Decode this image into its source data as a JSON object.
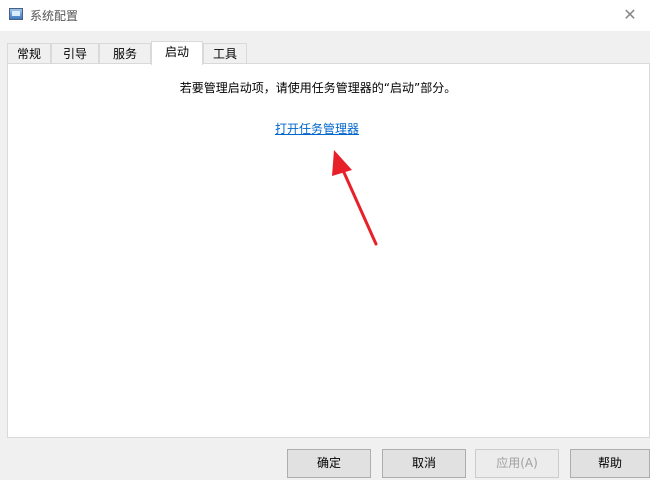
{
  "window": {
    "title": "系统配置",
    "icon": "msconfig-icon",
    "close_glyph": "✕"
  },
  "tabs": [
    {
      "label": "常规"
    },
    {
      "label": "引导"
    },
    {
      "label": "服务"
    },
    {
      "label": "启动",
      "active": true
    },
    {
      "label": "工具"
    }
  ],
  "startup": {
    "info": "若要管理启动项，请使用任务管理器的“启动”部分。",
    "link": "打开任务管理器"
  },
  "annotation": {
    "arrow_color": "#e8202a"
  },
  "buttons": {
    "ok": "确定",
    "cancel": "取消",
    "apply": "应用(A)",
    "help": "帮助"
  },
  "colors": {
    "link": "#0066cc",
    "window_bg": "#f0f0f0",
    "panel_bg": "#ffffff"
  }
}
